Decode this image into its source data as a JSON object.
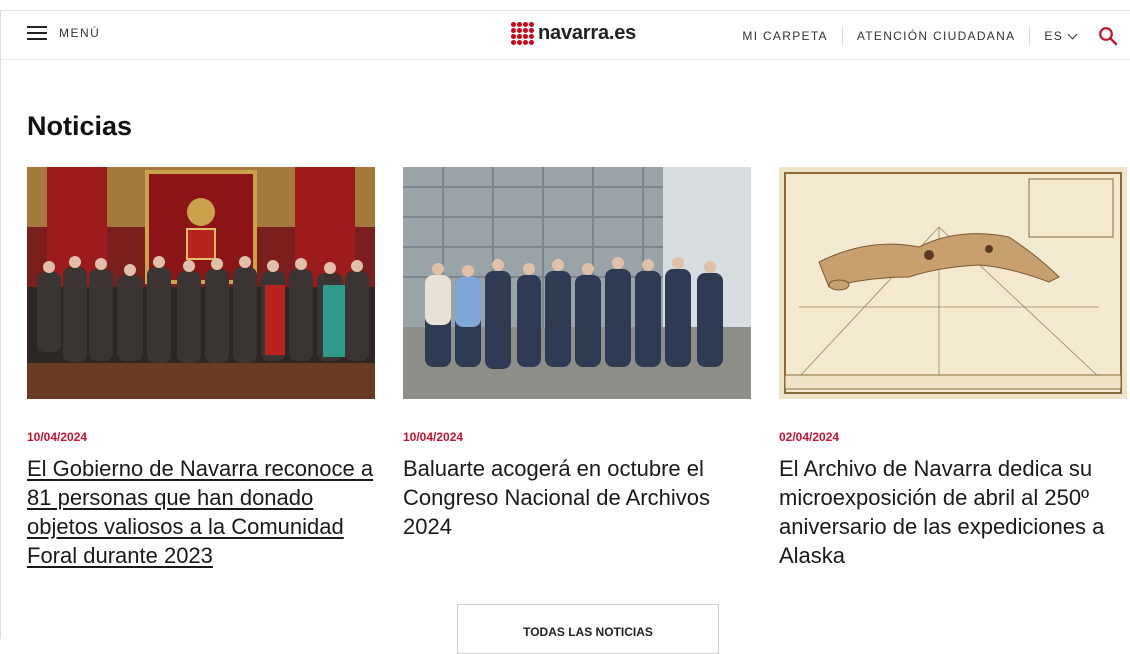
{
  "header": {
    "menu_label": "MENÚ",
    "logo_text": "navarra.es",
    "nav": {
      "mi_carpeta": "MI CARPETA",
      "atencion": "ATENCIÓN CIUDADANA",
      "lang": "ES"
    },
    "icons": {
      "menu": "hamburger-icon",
      "search": "search-icon",
      "lang": "chevron-down-icon"
    }
  },
  "main": {
    "heading": "Noticias",
    "news": [
      {
        "date": "10/04/2024",
        "title": "El Gobierno de Navarra reconoce a 81 personas que han donado objetos valiosos a la Comunidad Foral durante 2023"
      },
      {
        "date": "10/04/2024",
        "title": "Baluarte acogerá en octubre el Congreso Nacional de Archivos 2024"
      },
      {
        "date": "02/04/2024",
        "title": "El Archivo de Navarra dedica su microexposición de abril al 250º aniversario de las expediciones a Alaska"
      }
    ],
    "all_news_label": "TODAS LAS NOTICIAS"
  },
  "colors": {
    "accent": "#c4122f",
    "logo": "#d0021b"
  }
}
